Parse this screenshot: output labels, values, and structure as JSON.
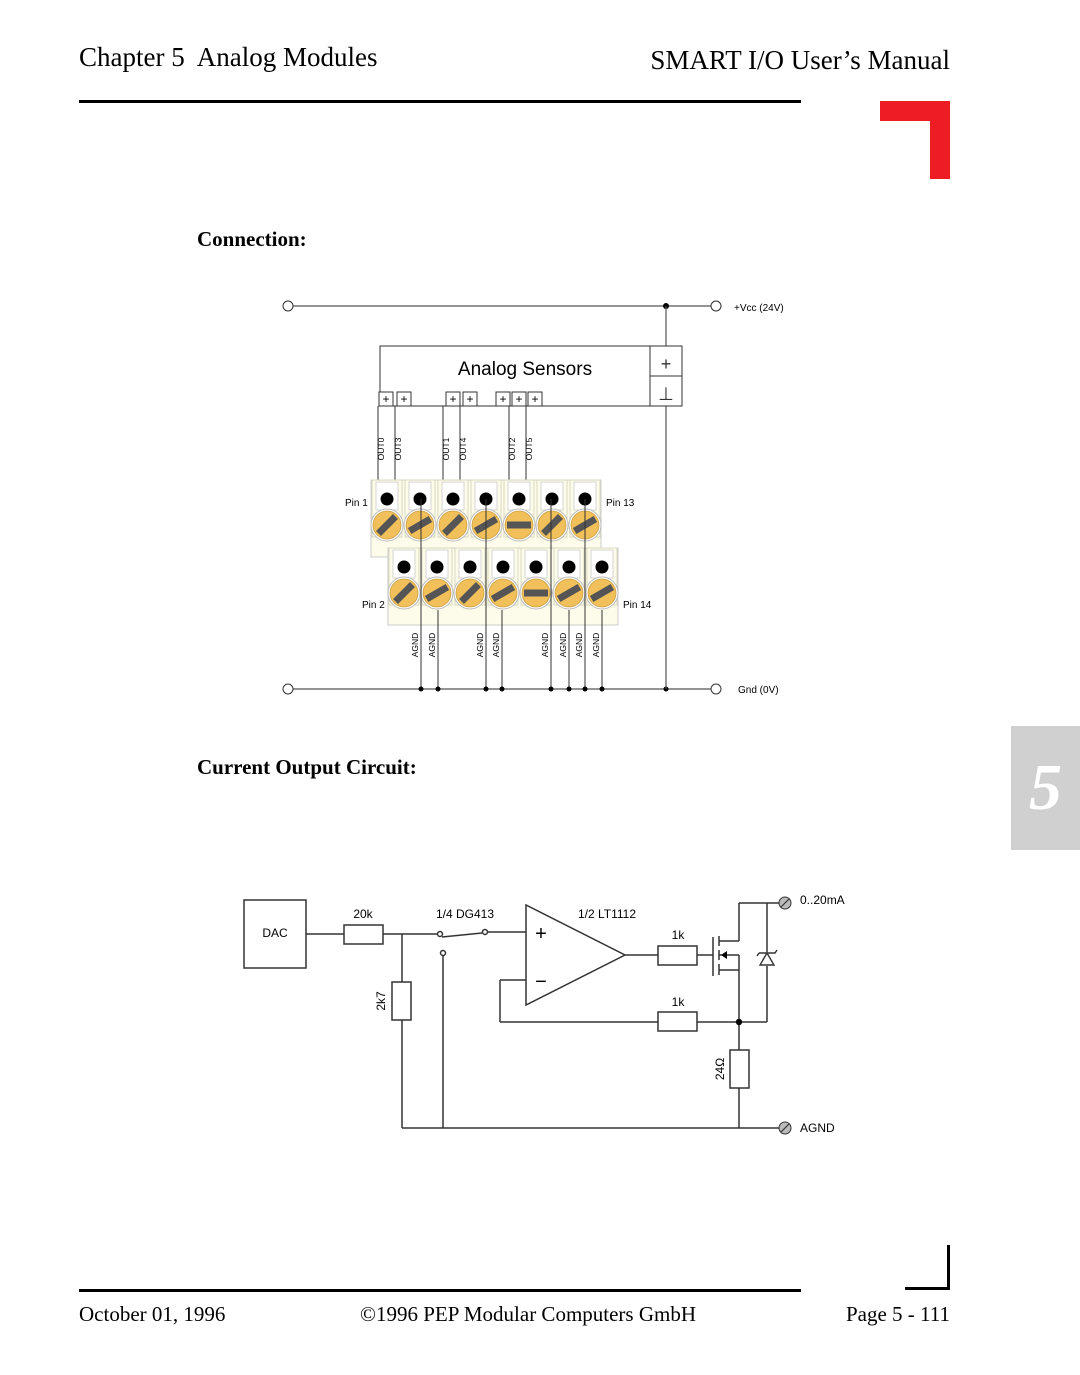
{
  "header": {
    "chapter": "Chapter 5  Analog Modules",
    "manual_title": "SMART I/O User’s Manual"
  },
  "sections": {
    "connection": "Connection:",
    "current_output": "Current Output Circuit:"
  },
  "chapter_tab": "5",
  "connection_diagram": {
    "block_label": "Analog Sensors",
    "vcc_label": "+Vcc (24V)",
    "gnd_label": "Gnd (0V)",
    "plus_symbol": "+",
    "ground_symbol": "⊥",
    "output_labels": [
      "OUT0",
      "OUT3",
      "OUT1",
      "OUT4",
      "OUT2",
      "OUT5"
    ],
    "agnd_labels": [
      "AGND",
      "AGND",
      "AGND",
      "AGND",
      "AGND",
      "AGND",
      "AGND",
      "AGND"
    ],
    "pin_labels": {
      "pin1": "Pin 1",
      "pin2": "Pin 2",
      "pin13": "Pin 13",
      "pin14": "Pin 14"
    },
    "terminal_color": "#f2c05a",
    "block_color": "#fdfcea"
  },
  "current_output_circuit": {
    "dac_label": "DAC",
    "r_series": "20k",
    "switch_label": "1/4 DG413",
    "opamp_label": "1/2 LT1112",
    "r_divider": "2k7",
    "r_gate": "1k",
    "r_feedback": "1k",
    "r_sense": "24Ω",
    "output_label": "0..20mA",
    "agnd_label": "AGND",
    "opamp_plus": "+",
    "opamp_minus": "−"
  },
  "footer": {
    "date": "October 01, 1996",
    "copyright": "©1996 PEP Modular Computers GmbH",
    "page": "Page 5 - 111"
  }
}
